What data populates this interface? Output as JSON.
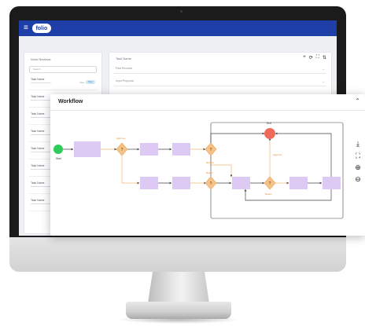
{
  "workflow": {
    "title": "Workflow",
    "collapse_icon": "chevron-up-icon",
    "start_label": "Start",
    "end_label": "End",
    "branch_labels": [
      "Approve",
      "Review",
      "Reject",
      "Approve",
      "Reject"
    ],
    "decision_symbol": "?",
    "toolbar_icons": [
      "download-icon",
      "fullscreen-icon",
      "zoom-in-icon",
      "zoom-out-icon"
    ],
    "toolbar_glyphs": [
      "⤓",
      "⛶",
      "⊕",
      "⊖"
    ]
  },
  "app": {
    "logo_text": "folio",
    "menu_glyph": "≡"
  },
  "left_panel": {
    "title": "Work Reviews",
    "search_placeholder": "Search",
    "tasks": [
      {
        "name": "Task Name",
        "status": "Due",
        "pill": "New"
      },
      {
        "name": "Task Name",
        "status": "",
        "pill": ""
      },
      {
        "name": "Task Name",
        "status": "",
        "pill": ""
      },
      {
        "name": "Task Name",
        "status": "",
        "pill": ""
      },
      {
        "name": "Task Name",
        "status": "",
        "pill": ""
      },
      {
        "name": "Task Name",
        "status": "",
        "pill": ""
      },
      {
        "name": "Task Name",
        "status": "",
        "pill": ""
      },
      {
        "name": "Task Name",
        "status": "",
        "pill": ""
      }
    ]
  },
  "right_panel": {
    "title": "Task Name",
    "tool_glyphs": [
      "+",
      "⟳",
      "⛶",
      "⇅"
    ],
    "fields": [
      "Past Records",
      "Input Proposal"
    ],
    "caret_glyph": "⌄"
  },
  "colors": {
    "brand": "#1e3ea8",
    "process_box": "#dccaf4",
    "decision": "#f3c38a",
    "start": "#2ecc5a",
    "end": "#f06a5a",
    "connector_orange": "#f2b877",
    "connector_purple": "#c9aef0"
  }
}
